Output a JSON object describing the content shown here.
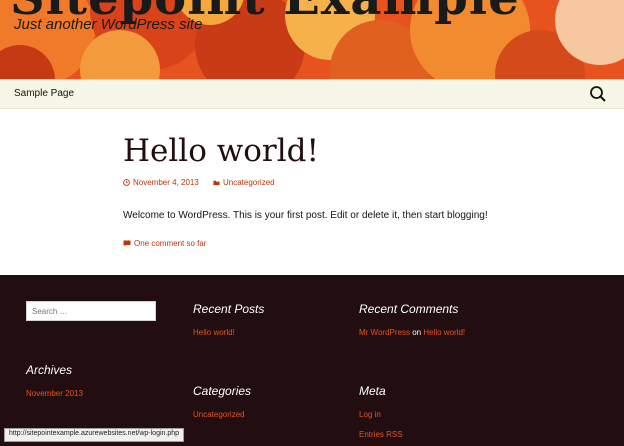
{
  "header": {
    "site_title": "Sitepoint Example",
    "site_description": "Just another WordPress site"
  },
  "nav": {
    "items": [
      {
        "label": "Sample Page"
      }
    ],
    "search_icon": "search-icon"
  },
  "post": {
    "title": "Hello world!",
    "date": "November 4, 2013",
    "category": "Uncategorized",
    "content": "Welcome to WordPress. This is your first post. Edit or delete it, then start blogging!",
    "comments": "One comment so far"
  },
  "footer": {
    "search_placeholder": "Search …",
    "recent_posts": {
      "title": "Recent Posts",
      "items": [
        "Hello world!"
      ]
    },
    "recent_comments": {
      "title": "Recent Comments",
      "author": "Mr WordPress",
      "on": "on",
      "post": "Hello world!"
    },
    "archives": {
      "title": "Archives",
      "items": [
        "November 2013"
      ]
    },
    "categories": {
      "title": "Categories",
      "items": [
        "Uncategorized"
      ]
    },
    "meta": {
      "title": "Meta",
      "items": [
        "Log in",
        "Entries RSS"
      ]
    }
  },
  "status_bar": "http://sitepointexample.azurewebsites.net/wp-login.php",
  "colors": {
    "accent": "#bc360a",
    "header_orange": "#e8521f",
    "footer_bg": "#220e10",
    "nav_bg": "#f7f5e7"
  }
}
